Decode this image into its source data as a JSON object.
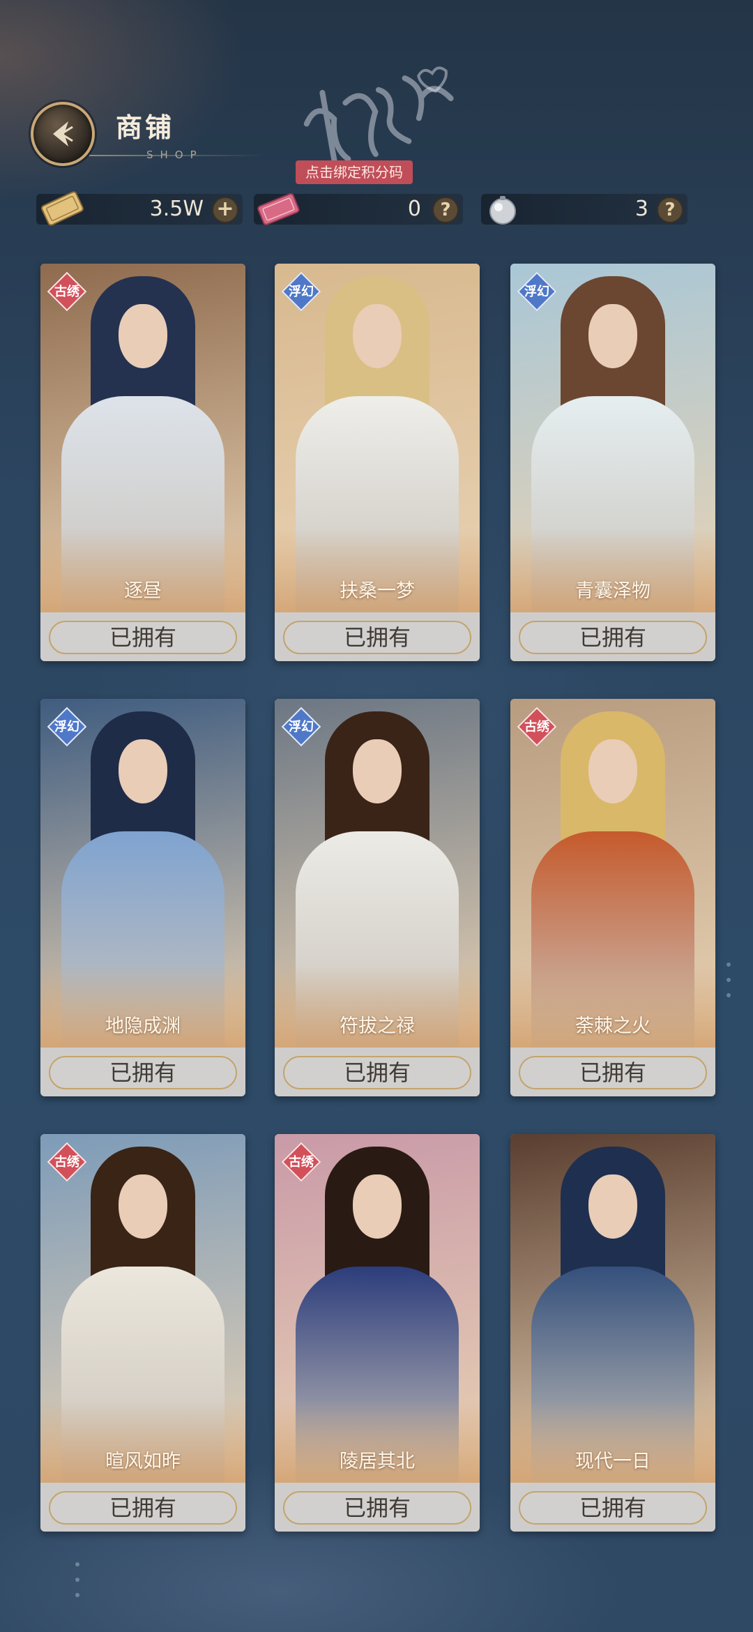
{
  "header": {
    "title": "商铺",
    "subtitle": "SHOP",
    "bind_tip": "点击绑定积分码"
  },
  "currencies": [
    {
      "icon": "gold-ticket-icon",
      "value": "3.5W",
      "action": "+"
    },
    {
      "icon": "points-ticket-icon",
      "value": "0",
      "action": "?"
    },
    {
      "icon": "pearl-orb-icon",
      "value": "3",
      "action": "?"
    }
  ],
  "cards": [
    {
      "name": "逐昼",
      "tag": "古绣",
      "tag_color": "red",
      "status": "已拥有",
      "hair": "#24324f",
      "bg": "#8f6b4e",
      "body": "#dde3ea"
    },
    {
      "name": "扶桑一梦",
      "tag": "浮幻",
      "tag_color": "blue",
      "status": "已拥有",
      "hair": "#d9bf84",
      "bg": "#d8b98f",
      "body": "#eeeeea"
    },
    {
      "name": "青囊泽物",
      "tag": "浮幻",
      "tag_color": "blue",
      "status": "已拥有",
      "hair": "#6b4630",
      "bg": "#a9c7d6",
      "body": "#e5eef0"
    },
    {
      "name": "地隐成渊",
      "tag": "浮幻",
      "tag_color": "blue",
      "status": "已拥有",
      "hair": "#1e2c47",
      "bg": "#3f5c80",
      "body": "#7fa3d0"
    },
    {
      "name": "符拔之禄",
      "tag": "浮幻",
      "tag_color": "blue",
      "status": "已拥有",
      "hair": "#3a2418",
      "bg": "#6c7784",
      "body": "#ecebe6"
    },
    {
      "name": "荼棘之火",
      "tag": "古绣",
      "tag_color": "red",
      "status": "已拥有",
      "hair": "#d9b86a",
      "bg": "#b89c80",
      "body": "#c65a2c"
    },
    {
      "name": "暄风如昨",
      "tag": "古绣",
      "tag_color": "red",
      "status": "已拥有",
      "hair": "#3a2416",
      "bg": "#7d9bb8",
      "body": "#ece7dd"
    },
    {
      "name": "陵居其北",
      "tag": "古绣",
      "tag_color": "red",
      "status": "已拥有",
      "hair": "#2a1a14",
      "bg": "#c99aa8",
      "body": "#2c3d7c"
    },
    {
      "name": "现代一日",
      "tag": "",
      "tag_color": "none",
      "status": "已拥有",
      "hair": "#1f2f4f",
      "bg": "#5a3e30",
      "body": "#34507c"
    }
  ],
  "colors": {
    "accent_gold": "#c9a877",
    "tag_red": "#d2505a",
    "tag_blue": "#4f78c8",
    "bind_tip_bg": "#c04e58"
  }
}
